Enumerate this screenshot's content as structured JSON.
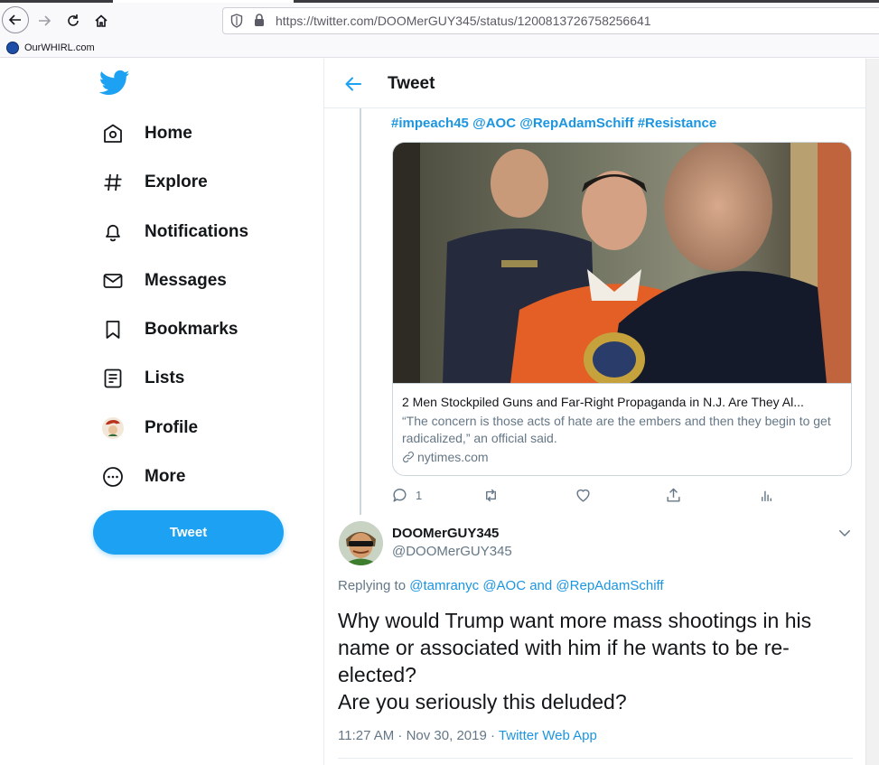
{
  "browser": {
    "url": "https://twitter.com/DOOMerGUY345/status/1200813726758256641",
    "bookmarks": [
      {
        "label": "OurWHIRL.com"
      }
    ]
  },
  "sidebar": {
    "items": [
      {
        "label": "Home",
        "icon": "home-icon"
      },
      {
        "label": "Explore",
        "icon": "hashtag-icon"
      },
      {
        "label": "Notifications",
        "icon": "bell-icon"
      },
      {
        "label": "Messages",
        "icon": "envelope-icon"
      },
      {
        "label": "Bookmarks",
        "icon": "bookmark-icon"
      },
      {
        "label": "Lists",
        "icon": "list-icon"
      },
      {
        "label": "Profile",
        "icon": "avatar-icon"
      },
      {
        "label": "More",
        "icon": "more-icon"
      }
    ],
    "tweet_button": "Tweet"
  },
  "header": {
    "title": "Tweet"
  },
  "parent_tweet": {
    "hashtags": [
      "#impeach45",
      "@AOC",
      "@RepAdamSchiff",
      "#Resistance"
    ],
    "card": {
      "title": "2 Men Stockpiled Guns and Far-Right Propaganda in N.J. Are They Al...",
      "description": "“The concern is those acts of hate are the embers and then they begin to get radicalized,” an official said.",
      "domain": "nytimes.com"
    },
    "actions": {
      "reply_count": "1"
    }
  },
  "reply_tweet": {
    "display_name": "DOOMerGUY345",
    "handle": "@DOOMerGUY345",
    "replying_prefix": "Replying to",
    "replying_user1": "@tamranyc",
    "replying_user2": "@AOC",
    "replying_and": "and",
    "replying_user3": "@RepAdamSchiff",
    "text_line1": "Why would Trump want more mass shootings in his name or associated with him if he wants to be re-elected?",
    "text_line2": "Are you seriously this deluded?",
    "timestamp": "11:27 AM · Nov 30, 2019",
    "separator": "·",
    "source": "Twitter Web App"
  },
  "colors": {
    "accent": "#1da1f2",
    "link": "#1b95e0",
    "muted": "#657786",
    "border": "#e6ecf0"
  }
}
